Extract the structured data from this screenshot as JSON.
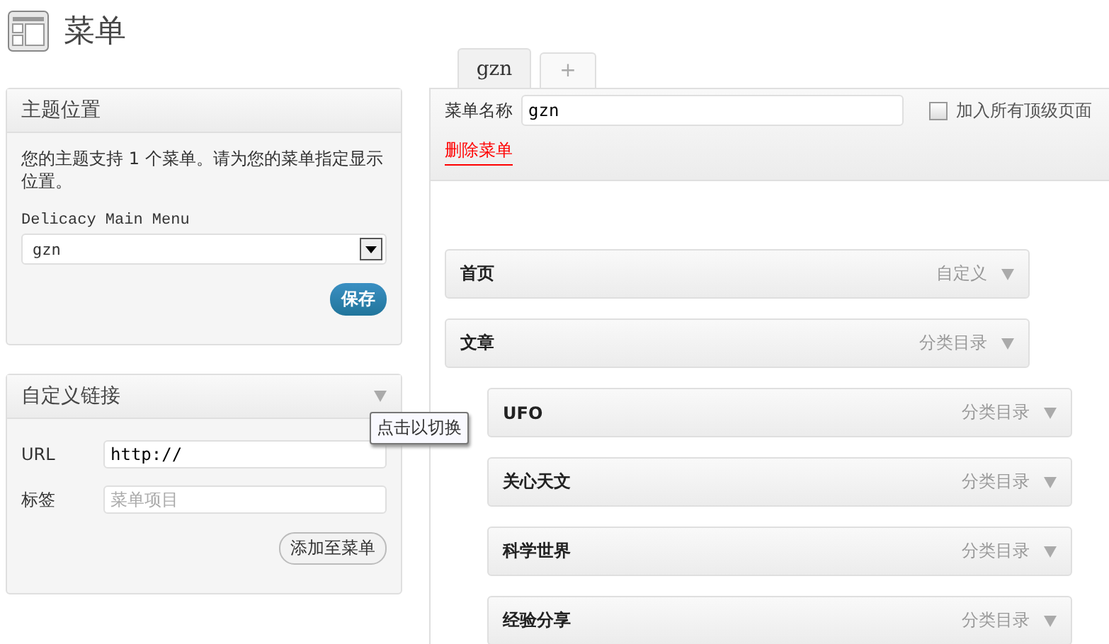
{
  "page_title": "菜单",
  "theme_locations": {
    "title": "主题位置",
    "description": "您的主题支持 1 个菜单。请为您的菜单指定显示位置。",
    "location_label": "Delicacy Main Menu",
    "selected_menu": "gzn",
    "save_button": "保存"
  },
  "custom_links": {
    "title": "自定义链接",
    "url_label": "URL",
    "url_value": "http://",
    "label_label": "标签",
    "label_placeholder": "菜单项目",
    "add_button": "添加至菜单",
    "tooltip": "点击以切换"
  },
  "tabs": [
    {
      "label": "gzn",
      "selected": true
    },
    {
      "label": "+",
      "selected": false
    }
  ],
  "menu_editor": {
    "name_label": "菜单名称",
    "name_value": "gzn",
    "auto_add_label": "加入所有顶级页面",
    "auto_add_checked": false,
    "delete_link": "删除菜单"
  },
  "menu_items": [
    {
      "title": "首页",
      "type": "自定义"
    },
    {
      "title": "文章",
      "type": "分类目录",
      "children": [
        {
          "title": "UFO",
          "type": "分类目录"
        },
        {
          "title": "关心天文",
          "type": "分类目录"
        },
        {
          "title": "科学世界",
          "type": "分类目录"
        },
        {
          "title": "经验分享",
          "type": "分类目录"
        }
      ]
    }
  ]
}
